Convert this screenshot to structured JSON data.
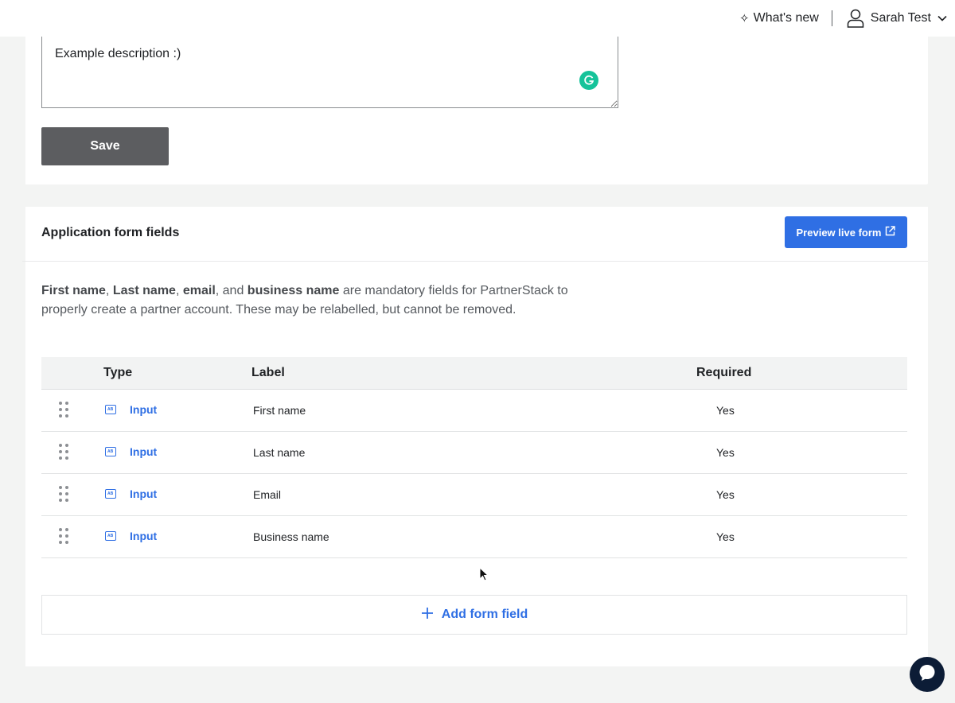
{
  "header": {
    "whats_new": "What's new",
    "user_name": "Sarah Test"
  },
  "description": {
    "value": "Example description :)"
  },
  "actions": {
    "save_label": "Save"
  },
  "fields_section": {
    "title": "Application form fields",
    "preview_label": "Preview live form",
    "notice": {
      "b1": "First name",
      "t1": ", ",
      "b2": "Last name",
      "t2": ", ",
      "b3": "email",
      "t3": ", and ",
      "b4": "business name",
      "t4": " are mandatory fields for PartnerStack to properly create a partner account. These may be relabelled, but cannot be removed."
    },
    "columns": {
      "type": "Type",
      "label": "Label",
      "required": "Required"
    },
    "rows": [
      {
        "type": "Input",
        "label": "First name",
        "required": "Yes"
      },
      {
        "type": "Input",
        "label": "Last name",
        "required": "Yes"
      },
      {
        "type": "Input",
        "label": "Email",
        "required": "Yes"
      },
      {
        "type": "Input",
        "label": "Business name",
        "required": "Yes"
      }
    ],
    "add_label": "Add form field"
  },
  "icons": {
    "whats_new": "sparkle-icon",
    "user": "user-icon",
    "chevron": "chevron-down-icon",
    "grammarly": "grammarly-icon",
    "external": "external-link-icon",
    "drag": "drag-handle-icon",
    "input_type": "text-input-icon",
    "add": "plus-icon",
    "chat": "chat-icon"
  },
  "colors": {
    "accent": "#2f6fe4",
    "save_button": "#5c5d60",
    "grammarly": "#15c39a",
    "chat": "#0c1c36"
  }
}
